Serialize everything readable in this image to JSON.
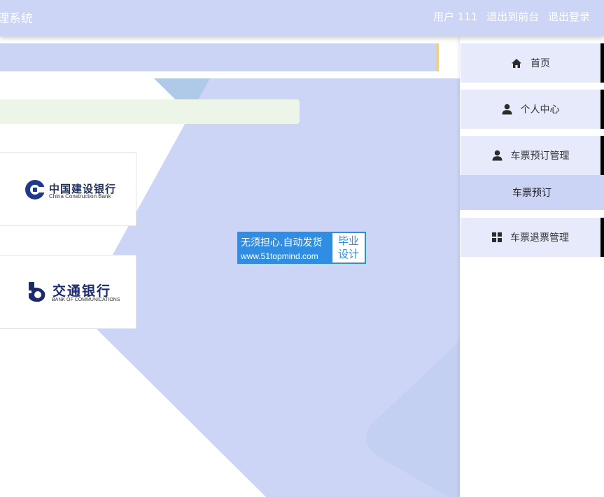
{
  "header": {
    "app_title": "理系统",
    "user_label": "用户 111",
    "back_to_front": "退出到前台",
    "logout": "退出登录"
  },
  "main": {
    "input_placeholder": "",
    "banks": [
      {
        "name_cn": "中国建设银行",
        "name_en": "China Construction Bank"
      },
      {
        "name_cn": "交通银行",
        "name_en": "BANK OF COMMUNICATIONS"
      }
    ]
  },
  "watermark": {
    "line1": "无须担心.自动发货",
    "line2": "www.51topmind.com",
    "badge_line1": "毕业",
    "badge_line2": "设计"
  },
  "sidebar": {
    "items": [
      {
        "label": "首页",
        "icon": "home-icon"
      },
      {
        "label": "个人中心",
        "icon": "user-icon"
      },
      {
        "label": "车票预订管理",
        "icon": "user-icon"
      },
      {
        "label": "车票预订",
        "icon": ""
      },
      {
        "label": "车票退票管理",
        "icon": "grid-icon"
      }
    ]
  },
  "colors": {
    "header_bg": "#cdd5f6",
    "menu_bg": "#e6eafb",
    "submenu_bg": "#ccd4f6",
    "watermark_blue": "#2f8de4"
  }
}
